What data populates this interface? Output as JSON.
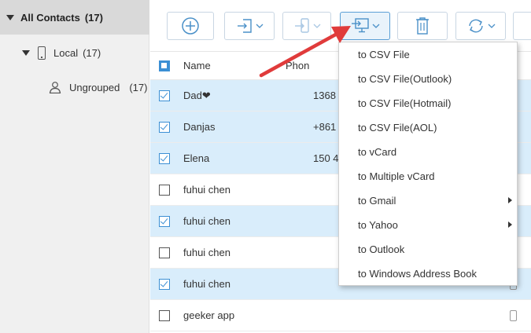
{
  "sidebar": {
    "all_contacts": "All Contacts",
    "all_contacts_count": "(17)",
    "local": "Local",
    "local_count": "(17)",
    "ungrouped": "Ungrouped",
    "ungrouped_count": "(17)"
  },
  "toolbar": {
    "buttons": [
      "add-icon",
      "import-icon",
      "export-to-device-icon",
      "export-to-computer-icon",
      "delete-icon",
      "refresh-icon"
    ]
  },
  "table": {
    "headers": {
      "name": "Name",
      "phone": "Phon"
    },
    "rows": [
      {
        "name": "Dad❤",
        "phone": "1368",
        "checked": true
      },
      {
        "name": "Danjas",
        "phone": "+861",
        "checked": true
      },
      {
        "name": "Elena",
        "phone": "150 4",
        "checked": true
      },
      {
        "name": "fuhui chen",
        "phone": "",
        "checked": false
      },
      {
        "name": "fuhui chen",
        "phone": "",
        "checked": true
      },
      {
        "name": "fuhui chen",
        "phone": "",
        "checked": false
      },
      {
        "name": "fuhui chen",
        "phone": "",
        "checked": true
      },
      {
        "name": "geeker app",
        "phone": "",
        "checked": false
      }
    ]
  },
  "export_menu": {
    "items": [
      {
        "label": "to CSV File",
        "submenu": false
      },
      {
        "label": "to CSV File(Outlook)",
        "submenu": false
      },
      {
        "label": "to CSV File(Hotmail)",
        "submenu": false
      },
      {
        "label": "to CSV File(AOL)",
        "submenu": false
      },
      {
        "label": "to vCard",
        "submenu": false
      },
      {
        "label": "to Multiple vCard",
        "submenu": false
      },
      {
        "label": "to Gmail",
        "submenu": true
      },
      {
        "label": "to Yahoo",
        "submenu": true
      },
      {
        "label": "to Outlook",
        "submenu": false
      },
      {
        "label": "to Windows Address Book",
        "submenu": false
      }
    ]
  },
  "colors": {
    "accent": "#3b8fd4",
    "selected_row": "#d9edfb",
    "annotation_arrow": "#e03b3b"
  }
}
